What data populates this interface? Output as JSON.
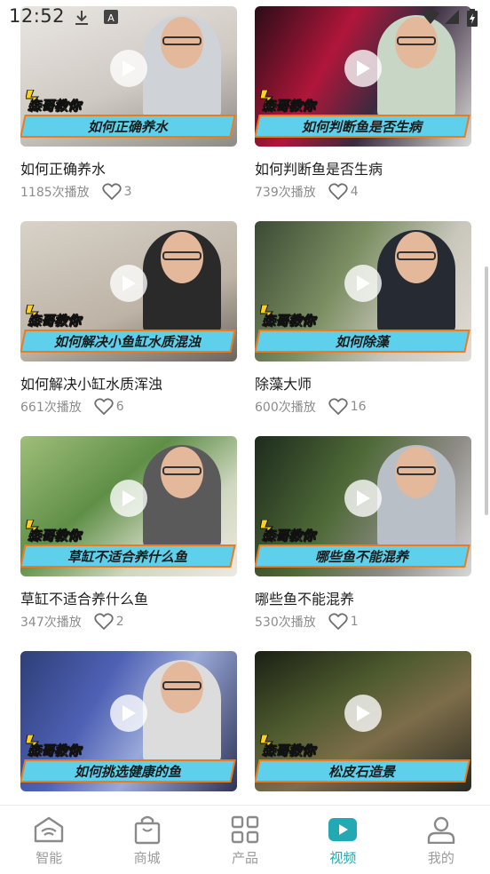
{
  "status_bar": {
    "time": "12:52"
  },
  "videos": [
    {
      "title": "如何正确养水",
      "banner": "如何正确养水",
      "tag": "森哥教你",
      "plays": "1185次播放",
      "likes": "3"
    },
    {
      "title": "如何判断鱼是否生病",
      "banner": "如何判断鱼是否生病",
      "tag": "森哥教你",
      "plays": "739次播放",
      "likes": "4"
    },
    {
      "title": "如何解决小缸水质浑浊",
      "banner": "如何解决小鱼缸水质混浊",
      "tag": "森哥教你",
      "plays": "661次播放",
      "likes": "6"
    },
    {
      "title": "除藻大师",
      "banner": "如何除藻",
      "tag": "森哥教你",
      "plays": "600次播放",
      "likes": "16"
    },
    {
      "title": "草缸不适合养什么鱼",
      "banner": "草缸不适合养什么鱼",
      "tag": "森哥教你",
      "plays": "347次播放",
      "likes": "2"
    },
    {
      "title": "哪些鱼不能混养",
      "banner": "哪些鱼不能混养",
      "tag": "森哥教你",
      "plays": "530次播放",
      "likes": "1"
    },
    {
      "title": "",
      "banner": "如何挑选健康的鱼",
      "tag": "森哥教你",
      "plays": "",
      "likes": ""
    },
    {
      "title": "",
      "banner": "松皮石造景",
      "tag": "森哥教你",
      "plays": "",
      "likes": ""
    }
  ],
  "nav": [
    {
      "label": "智能",
      "icon": "smart-home-icon",
      "active": false
    },
    {
      "label": "商城",
      "icon": "shopping-bag-icon",
      "active": false
    },
    {
      "label": "产品",
      "icon": "grid-icon",
      "active": false
    },
    {
      "label": "视频",
      "icon": "video-play-icon",
      "active": true
    },
    {
      "label": "我的",
      "icon": "user-icon",
      "active": false
    }
  ],
  "colors": {
    "accent": "#22a9b3",
    "banner": "#5fd0ec",
    "banner_border": "#f07a1a"
  }
}
